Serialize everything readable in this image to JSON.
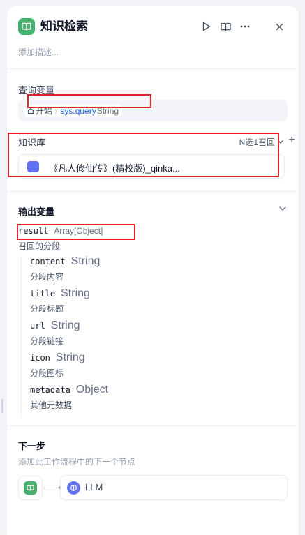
{
  "header": {
    "title": "知识检索",
    "description_placeholder": "添加描述..."
  },
  "query": {
    "label": "查询变量",
    "start": "开始",
    "variable": "sys.query",
    "type": "String"
  },
  "knowledge": {
    "label": "知识库",
    "retrieval_mode": "N选1召回",
    "add": "+",
    "item": "《凡人修仙传》(精校版)_qinka..."
  },
  "output": {
    "label": "输出变量",
    "result_name": "result",
    "result_type": "Array[Object]",
    "result_desc": "召回的分段",
    "fields": [
      {
        "name": "content",
        "type": "String",
        "desc": "分段内容"
      },
      {
        "name": "title",
        "type": "String",
        "desc": "分段标题"
      },
      {
        "name": "url",
        "type": "String",
        "desc": "分段链接"
      },
      {
        "name": "icon",
        "type": "String",
        "desc": "分段图标"
      },
      {
        "name": "metadata",
        "type": "Object",
        "desc": "其他元数据"
      }
    ]
  },
  "next": {
    "label": "下一步",
    "description": "添加此工作流程中的下一个节点",
    "node": "LLM"
  },
  "colors": {
    "accent_green": "#47b26d",
    "accent_indigo": "#6172f3",
    "variable_blue": "#155eef",
    "annotation_red": "#e0222b"
  }
}
